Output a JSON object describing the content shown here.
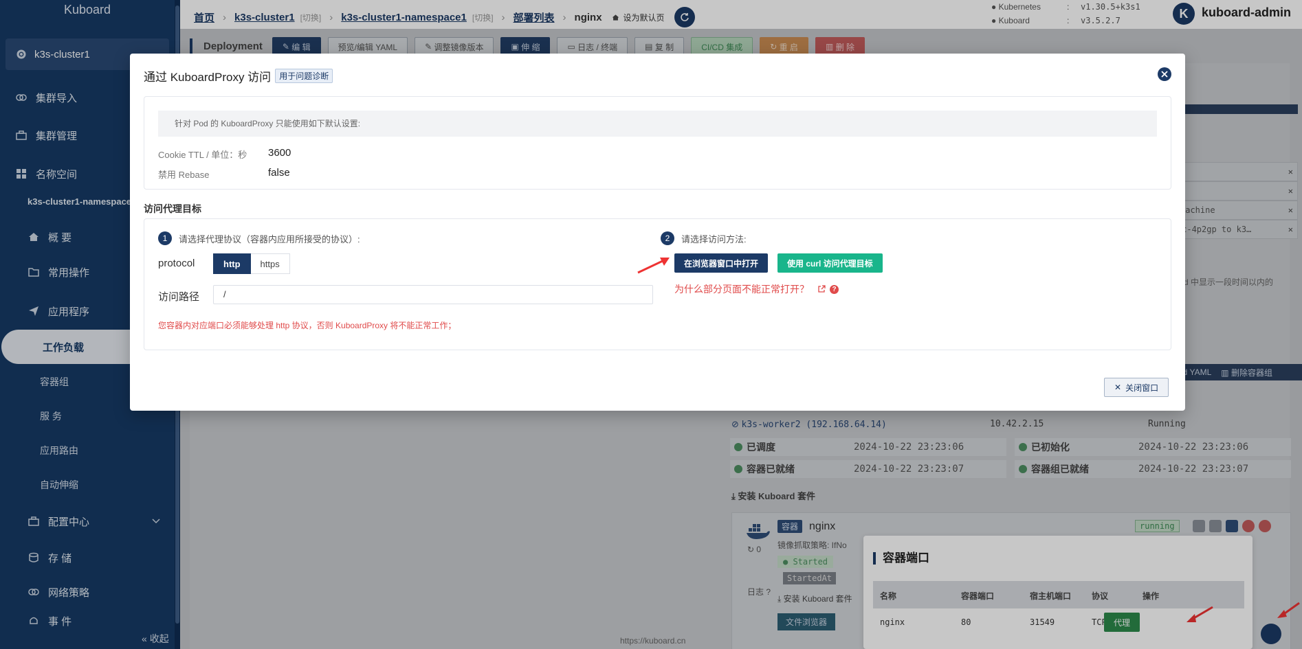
{
  "sidebar": {
    "logo": "Kuboard",
    "cluster": "k3s-cluster1",
    "items": [
      {
        "label": "集群导入",
        "icon": "link-icon"
      },
      {
        "label": "集群管理",
        "icon": "briefcase-icon"
      },
      {
        "label": "名称空间",
        "icon": "grid-icon"
      }
    ],
    "namespace": "k3s-cluster1-namespace1",
    "ns_items": [
      {
        "label": "概 要",
        "icon": "home-icon"
      },
      {
        "label": "常用操作",
        "icon": "folder-icon"
      },
      {
        "label": "应用程序",
        "icon": "send-icon"
      }
    ],
    "active": "工作负载",
    "sub_items": [
      "容器组",
      "服 务",
      "应用路由",
      "自动伸缩"
    ],
    "more_items": [
      {
        "label": "配置中心",
        "icon": "briefcase-icon"
      },
      {
        "label": "存 储",
        "icon": "database-icon"
      },
      {
        "label": "网络策略",
        "icon": "link-icon"
      },
      {
        "label": "事 件",
        "icon": "bell-icon"
      }
    ],
    "collapse": "收起"
  },
  "topbar": {
    "crumbs": {
      "home": "首页",
      "cluster": "k3s-cluster1",
      "switch": "[切换]",
      "namespace": "k3s-cluster1-namespace1",
      "list": "部署列表",
      "current": "nginx",
      "set_default": "设为默认页"
    },
    "versions": [
      {
        "k": "Kubernetes",
        "v": "v1.30.5+k3s1"
      },
      {
        "k": "Kuboard",
        "v": "v3.5.2.7"
      }
    ],
    "avatar": "K",
    "user": "kuboard-admin"
  },
  "toolbar": {
    "title": "Deployment",
    "buttons": [
      "编 辑",
      "预览/编辑 YAML",
      "调整镜像版本",
      "伸 缩",
      "日志 / 终端",
      "复 制",
      "CI/CD 集成",
      "重 启",
      "删 除"
    ]
  },
  "background": {
    "rows": [
      "",
      "",
      "machine",
      "94464c-4p2gp to k3…"
    ],
    "note": "d 中显示一段时间以内的",
    "dark_strip": [
      "Pod YAML",
      "删除容器组"
    ],
    "node": "k3s-worker2 (192.168.64.14)",
    "ip": "10.42.2.15",
    "status": "Running",
    "conditions": [
      {
        "label": "已调度",
        "time": "2024-10-22 23:23:06"
      },
      {
        "label": "已初始化",
        "time": "2024-10-22 23:23:06"
      },
      {
        "label": "容器已就绪",
        "time": "2024-10-22 23:23:07"
      },
      {
        "label": "容器组已就绪",
        "time": "2024-10-22 23:23:07"
      }
    ],
    "install_suite": "安装 Kuboard 套件",
    "container": {
      "tag": "容器",
      "name": "nginx",
      "pull_policy": "镜像抓取策略: IfNo",
      "restarts": "0",
      "started": "Started",
      "started_at": "StartedAt",
      "logs": "日志",
      "running": "running",
      "install": "安装 Kuboard 套件",
      "file_browser": "文件浏览器"
    },
    "ports": {
      "title": "容器端口",
      "headers": [
        "名称",
        "容器端口",
        "宿主机端口",
        "协议",
        "操作"
      ],
      "row": [
        "nginx",
        "80",
        "31549",
        "TCP"
      ],
      "action": "代理"
    },
    "footer": "https://kuboard.cn"
  },
  "modal": {
    "title": "通过 KuboardProxy 访问",
    "tag": "用于问题诊断",
    "defaults_note": "针对 Pod 的 KuboardProxy 只能使用如下默认设置:",
    "cookie_label": "Cookie TTL / 单位：秒",
    "cookie_value": "3600",
    "rebase_label": "禁用 Rebase",
    "rebase_value": "false",
    "target_title": "访问代理目标",
    "step1_num": "1",
    "step1": "请选择代理协议（容器内应用所接受的协议）:",
    "protocol_label": "protocol",
    "protocol_options": [
      "http",
      "https"
    ],
    "path_label": "访问路径",
    "path_value": "/",
    "warning": "您容器内对应端口必须能够处理 http 协议，否则 KuboardProxy 将不能正常工作；",
    "step2_num": "2",
    "step2": "请选择访问方法:",
    "open_btn": "在浏览器窗口中打开",
    "curl_btn": "使用 curl 访问代理目标",
    "why": "为什么部分页面不能正常打开？",
    "close_btn": "关闭窗口"
  }
}
